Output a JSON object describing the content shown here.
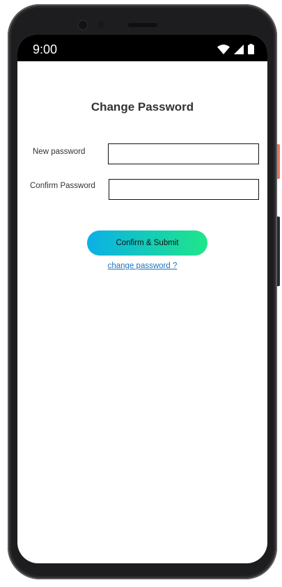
{
  "status_bar": {
    "time": "9:00",
    "icons": [
      "wifi-icon",
      "cellular-signal-icon",
      "battery-icon"
    ]
  },
  "page": {
    "title": "Change Password"
  },
  "form": {
    "new_password_label": "New password",
    "new_password_value": "",
    "confirm_password_label": "Confirm Password",
    "confirm_password_value": "",
    "submit_label": "Confirm & Submit",
    "link_label": "change password ?"
  },
  "colors": {
    "gradient_start": "#0bb0e6",
    "gradient_end": "#1fe68a",
    "link": "#1e73be",
    "status_bar": "#000000"
  }
}
